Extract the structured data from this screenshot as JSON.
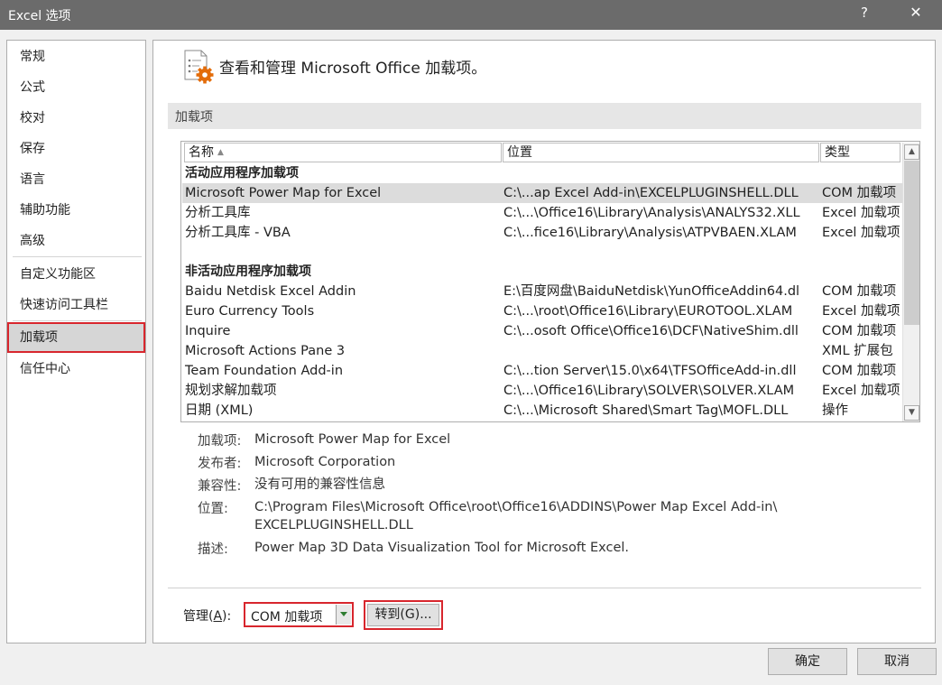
{
  "window": {
    "title": "Excel 选项",
    "help_label": "?",
    "close_label": "✕"
  },
  "nav": {
    "items": [
      {
        "label": "常规"
      },
      {
        "label": "公式"
      },
      {
        "label": "校对"
      },
      {
        "label": "保存"
      },
      {
        "label": "语言"
      },
      {
        "label": "辅助功能"
      },
      {
        "label": "高级"
      },
      {
        "label": "自定义功能区"
      },
      {
        "label": "快速访问工具栏"
      },
      {
        "label": "加载项"
      },
      {
        "label": "信任中心"
      }
    ],
    "selected": "加载项"
  },
  "header": {
    "text": "查看和管理 Microsoft Office 加载项。",
    "icon": "addins-gear-icon"
  },
  "section": {
    "title": "加载项"
  },
  "table": {
    "columns": {
      "name": "名称",
      "location": "位置",
      "type": "类型"
    },
    "sort_indicator": "▲",
    "active_group": "活动应用程序加载项",
    "active_rows": [
      {
        "name": "Microsoft Power Map for Excel",
        "location": "C:\\...ap Excel Add-in\\EXCELPLUGINSHELL.DLL",
        "type": "COM 加载项"
      },
      {
        "name": "分析工具库",
        "location": "C:\\...\\Office16\\Library\\Analysis\\ANALYS32.XLL",
        "type": "Excel 加载项"
      },
      {
        "name": "分析工具库 - VBA",
        "location": "C:\\...fice16\\Library\\Analysis\\ATPVBAEN.XLAM",
        "type": "Excel 加载项"
      }
    ],
    "inactive_group": "非活动应用程序加载项",
    "inactive_rows": [
      {
        "name": "Baidu Netdisk Excel Addin",
        "location": "E:\\百度网盘\\BaiduNetdisk\\YunOfficeAddin64.dl",
        "type": "COM 加载项"
      },
      {
        "name": "Euro Currency Tools",
        "location": "C:\\...\\root\\Office16\\Library\\EUROTOOL.XLAM",
        "type": "Excel 加载项"
      },
      {
        "name": "Inquire",
        "location": "C:\\...osoft Office\\Office16\\DCF\\NativeShim.dll",
        "type": "COM 加载项"
      },
      {
        "name": "Microsoft Actions Pane 3",
        "location": "",
        "type": "XML 扩展包"
      },
      {
        "name": "Team Foundation Add-in",
        "location": "C:\\...tion Server\\15.0\\x64\\TFSOfficeAdd-in.dll",
        "type": "COM 加载项"
      },
      {
        "name": "规划求解加载项",
        "location": "C:\\...\\Office16\\Library\\SOLVER\\SOLVER.XLAM",
        "type": "Excel 加载项"
      },
      {
        "name": "日期 (XML)",
        "location": "C:\\...\\Microsoft Shared\\Smart Tag\\MOFL.DLL",
        "type": "操作"
      }
    ],
    "scroll_up": "▲",
    "scroll_down": "▼"
  },
  "details": {
    "addin_label": "加载项:",
    "addin_value": "Microsoft Power Map for Excel",
    "publisher_label": "发布者:",
    "publisher_value": "Microsoft Corporation",
    "compat_label": "兼容性:",
    "compat_value": "没有可用的兼容性信息",
    "location_label": "位置:",
    "location_line1": "C:\\Program Files\\Microsoft Office\\root\\Office16\\ADDINS\\Power Map Excel Add-in\\",
    "location_line2": "EXCELPLUGINSHELL.DLL",
    "desc_label": "描述:",
    "desc_value": "Power Map 3D Data Visualization Tool for Microsoft Excel."
  },
  "manage": {
    "label_prefix": "管理(",
    "label_key": "A",
    "label_suffix": "):",
    "selected": "COM 加载项",
    "go_label": "转到(G)..."
  },
  "footer": {
    "ok_label": "确定",
    "cancel_label": "取消"
  },
  "colors": {
    "highlight_border": "#d8262d",
    "titlebar": "#6b6b6b"
  }
}
